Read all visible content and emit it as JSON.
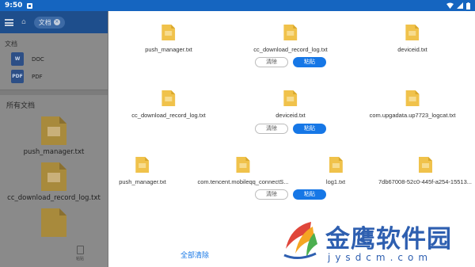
{
  "status_bar": {
    "time": "9:50"
  },
  "background_app": {
    "tab_label": "文档",
    "section_label": "文档",
    "types": [
      {
        "icon_text": "W",
        "label": "DOC"
      },
      {
        "icon_text": "PDF",
        "label": "PDF"
      }
    ],
    "all_docs_label": "所有文档",
    "files": [
      "push_manager.txt",
      "cc_download_record_log.txt"
    ],
    "bottom_paste_label": "粘贴"
  },
  "sheet": {
    "groups": [
      {
        "files": [
          "push_manager.txt",
          "cc_download_record_log.txt",
          "deviceid.txt"
        ],
        "clear_label": "清除",
        "paste_label": "粘贴"
      },
      {
        "files": [
          "cc_download_record_log.txt",
          "deviceid.txt",
          "com.upgadata.up7723_logcat.txt"
        ],
        "clear_label": "清除",
        "paste_label": "粘贴"
      },
      {
        "files": [
          "push_manager.txt",
          "com.tencent.mobileqq_connectS...",
          "log1.txt",
          "7db67008-52c0-445f-a254-15513..."
        ],
        "clear_label": "清除",
        "paste_label": "粘贴"
      }
    ],
    "clear_all_label": "全部清除"
  },
  "watermark": {
    "title": "金鹰软件园",
    "subtitle": "jysdcm.com"
  },
  "colors": {
    "accent": "#1677e6",
    "file_icon": "#f0c24b",
    "status_bar": "#1565c0"
  }
}
